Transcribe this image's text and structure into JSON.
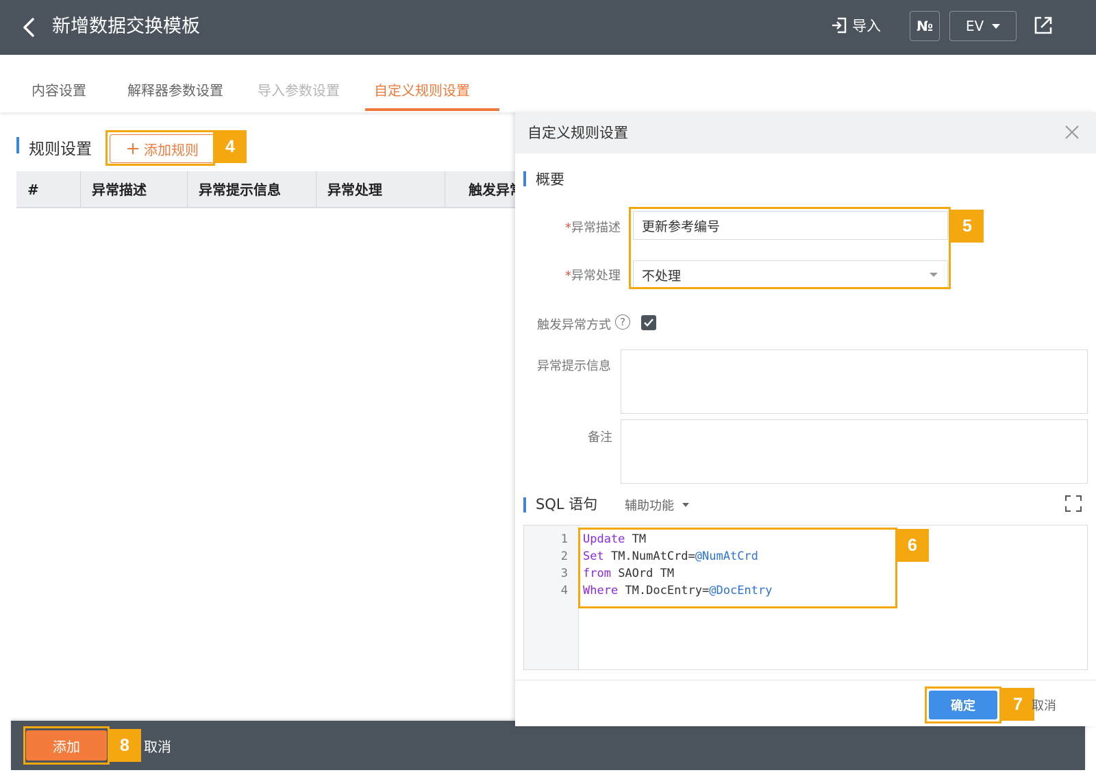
{
  "header": {
    "title": "新增数据交换模板",
    "import_label": "导入",
    "no_label": "№",
    "ev_label": "EV"
  },
  "tabs": [
    {
      "label": "内容设置",
      "state": "normal"
    },
    {
      "label": "解释器参数设置",
      "state": "normal"
    },
    {
      "label": "导入参数设置",
      "state": "disabled"
    },
    {
      "label": "自定义规则设置",
      "state": "active"
    }
  ],
  "rules": {
    "section_title": "规则设置",
    "add_rule_label": "添加规则",
    "columns": [
      "#",
      "异常描述",
      "异常提示信息",
      "异常处理",
      "触发异常方式"
    ]
  },
  "panel": {
    "title": "自定义规则设置",
    "overview_title": "概要",
    "fields": {
      "exception_desc_label": "异常描述",
      "exception_desc_value": "更新参考编号",
      "exception_handling_label": "异常处理",
      "exception_handling_value": "不处理",
      "trigger_label": "触发异常方式",
      "trigger_checked": true,
      "tip_label": "异常提示信息",
      "tip_value": "",
      "remark_label": "备注",
      "remark_value": ""
    },
    "sql": {
      "title": "SQL 语句",
      "assist_label": "辅助功能",
      "lines": [
        {
          "num": "1",
          "kw": "Update",
          "rest": " TM",
          "var": ""
        },
        {
          "num": "2",
          "kw": "Set",
          "rest": " TM.NumAtCrd=",
          "var": "@NumAtCrd"
        },
        {
          "num": "3",
          "kw": "from",
          "rest": " SAOrd TM",
          "var": ""
        },
        {
          "num": "4",
          "kw": "Where",
          "rest": " TM.DocEntry=",
          "var": "@DocEntry"
        }
      ]
    },
    "confirm_label": "确定",
    "cancel_label": "取消"
  },
  "footer": {
    "add_label": "添加",
    "cancel_label": "取消"
  },
  "callouts": [
    "4",
    "5",
    "6",
    "7",
    "8"
  ],
  "colors": {
    "topbar": "#4b535c",
    "accent_orange": "#f07a3a",
    "callout": "#f5a70f",
    "primary_blue": "#3f8fe8",
    "sql_keyword": "#8a2be2",
    "sql_variable": "#2b73d6"
  }
}
